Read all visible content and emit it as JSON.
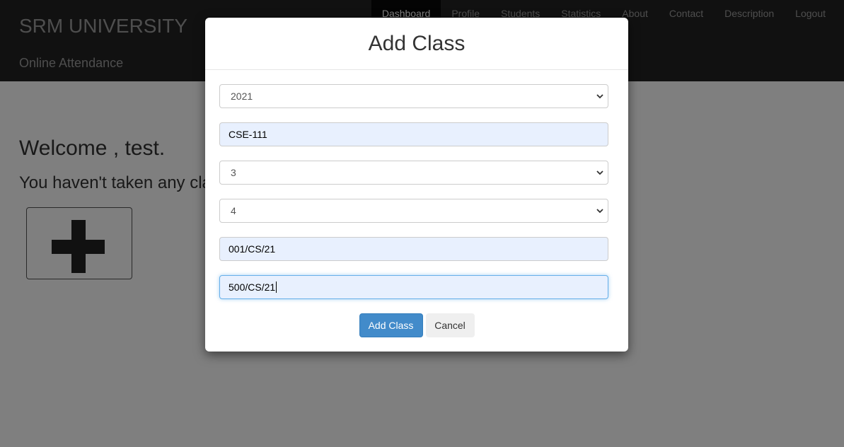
{
  "header": {
    "brand": "SRM UNIVERSITY",
    "subtitle": "Online Attendance",
    "nav": [
      {
        "label": "Dashboard",
        "active": true
      },
      {
        "label": "Profile"
      },
      {
        "label": "Students"
      },
      {
        "label": "Statistics"
      },
      {
        "label": "About"
      },
      {
        "label": "Contact"
      },
      {
        "label": "Description"
      },
      {
        "label": "Logout"
      }
    ]
  },
  "main": {
    "welcome": "Welcome , test.",
    "no_class": "You haven't taken any cla",
    "add_tile_icon": "plus-icon"
  },
  "modal": {
    "title": "Add Class",
    "fields": {
      "year": "2021",
      "course_code": "CSE-111",
      "field3": "3",
      "field4": "4",
      "roll_start": "001/CS/21",
      "roll_end": "500/CS/21"
    },
    "submit_label": "Add Class",
    "cancel_label": "Cancel"
  },
  "colors": {
    "navbar": "#222222",
    "primary": "#428bca",
    "autofill": "#e8f0fe"
  }
}
